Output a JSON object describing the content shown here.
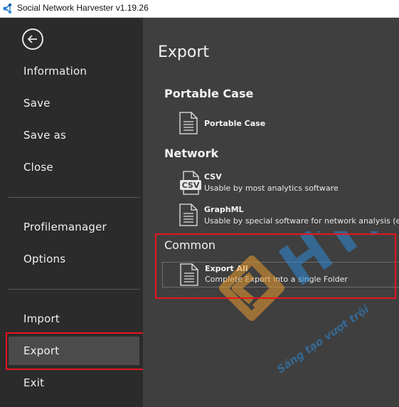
{
  "window": {
    "title": "Social Network Harvester v1.19.26",
    "app_icon": "network-graph-icon"
  },
  "sidebar": {
    "back_icon": "back-arrow-icon",
    "items_top": [
      {
        "label": "Information"
      },
      {
        "label": "Save"
      },
      {
        "label": "Save as"
      },
      {
        "label": "Close"
      }
    ],
    "items_middle": [
      {
        "label": "Profilemanager"
      },
      {
        "label": "Options"
      }
    ],
    "items_bottom": [
      {
        "label": "Import"
      },
      {
        "label": "Export",
        "active": true
      },
      {
        "label": "Exit"
      }
    ]
  },
  "main": {
    "title": "Export",
    "sections": {
      "portable": {
        "heading": "Portable Case",
        "item": {
          "title": "Portable Case",
          "icon": "document-icon"
        }
      },
      "network": {
        "heading": "Network",
        "csv": {
          "title": "CSV",
          "description": "Usable by most analytics software",
          "icon": "csv-file-icon"
        },
        "graphml": {
          "title": "GraphML",
          "description": "Usable by special software for network analysis (eg Gephi)",
          "icon": "document-icon"
        }
      },
      "common": {
        "heading": "Common",
        "export_all": {
          "title": "Export All",
          "description": "Complete Export into a single Folder",
          "icon": "document-icon"
        }
      }
    }
  },
  "watermark": {
    "logo_text": "HTI",
    "tagline": "Sáng tạo vượt trội",
    "colors": {
      "orange": "#e89a2e",
      "blue": "#2e8bd6"
    }
  },
  "highlight_color": "#e8141c"
}
